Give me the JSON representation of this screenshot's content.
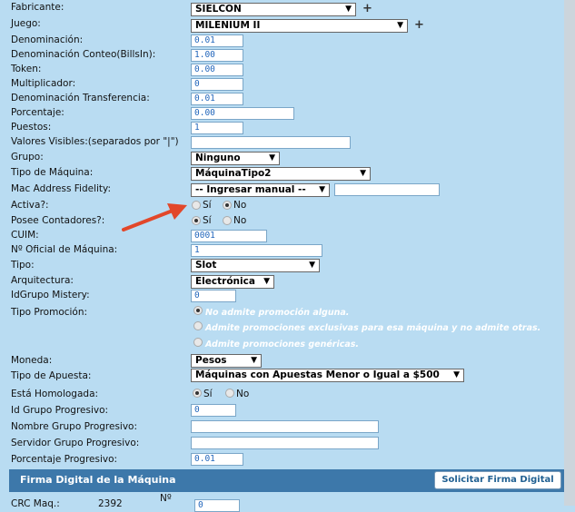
{
  "form": {
    "fabricante": {
      "label": "Fabricante:",
      "value": "SIELCON"
    },
    "juego": {
      "label": "Juego:",
      "value": "MILENIUM II"
    },
    "denominacion": {
      "label": "Denominación:",
      "value": "0.01"
    },
    "denom_conteo": {
      "label": "Denominación Conteo(BillsIn):",
      "value": "1.00"
    },
    "token": {
      "label": "Token:",
      "value": "0.00"
    },
    "multiplicador": {
      "label": "Multiplicador:",
      "value": "0"
    },
    "denom_transferencia": {
      "label": "Denominación Transferencia:",
      "value": "0.01"
    },
    "porcentaje": {
      "label": "Porcentaje:",
      "value": "0.00"
    },
    "puestos": {
      "label": "Puestos:",
      "value": "1"
    },
    "valores_visibles": {
      "label": "Valores Visibles:(separados por \"|\")",
      "value": ""
    },
    "grupo": {
      "label": "Grupo:",
      "value": "Ninguno"
    },
    "tipo_maquina": {
      "label": "Tipo de Máquina:",
      "value": "MáquinaTipo2"
    },
    "mac_address": {
      "label": "Mac Address Fidelity:",
      "value": "-- Ingresar manual --",
      "text": ""
    },
    "activa": {
      "label": "Activa?:",
      "opt_si": "Sí",
      "opt_no": "No"
    },
    "posee_contadores": {
      "label": "Posee Contadores?:",
      "opt_si": "Sí",
      "opt_no": "No"
    },
    "cuim": {
      "label": "CUIM:",
      "value": "0001"
    },
    "num_oficial": {
      "label": "Nº Oficial de Máquina:",
      "value": "1"
    },
    "tipo": {
      "label": "Tipo:",
      "value": "Slot"
    },
    "arquitectura": {
      "label": "Arquitectura:",
      "value": "Electrónica"
    },
    "idgrupo_mistery": {
      "label": "IdGrupo Mistery:",
      "value": "0"
    },
    "tipo_promocion": {
      "label": "Tipo Promoción:",
      "options": [
        "No admite promoción alguna.",
        "Admite promociones exclusivas para esa máquina y no admite otras.",
        "Admite promociones genéricas."
      ]
    },
    "moneda": {
      "label": "Moneda:",
      "value": "Pesos"
    },
    "tipo_apuesta": {
      "label": "Tipo de Apuesta:",
      "value": "Máquinas con Apuestas Menor o Igual a $500"
    },
    "homologada": {
      "label": "Está Homologada:",
      "opt_si": "Sí",
      "opt_no": "No"
    },
    "id_grupo_progresivo": {
      "label": "Id Grupo Progresivo:",
      "value": "0"
    },
    "nombre_grupo_progresivo": {
      "label": "Nombre Grupo Progresivo:",
      "value": ""
    },
    "servidor_grupo_progresivo": {
      "label": "Servidor Grupo Progresivo:",
      "value": ""
    },
    "porcentaje_progresivo": {
      "label": "Porcentaje Progresivo:",
      "value": "0.01"
    }
  },
  "firma": {
    "title": "Firma Digital de la Máquina",
    "button": "Solicitar Firma Digital",
    "crc_label": "CRC Maq.:",
    "crc_value": "2392",
    "num_label": "Nº",
    "num_value": "0"
  },
  "icons": {
    "plus": "+",
    "dropdown": "▼"
  },
  "colors": {
    "background": "#b9dcf2",
    "header": "#3d78aa",
    "arrow": "#e2472a",
    "input_text": "#2266bb"
  }
}
